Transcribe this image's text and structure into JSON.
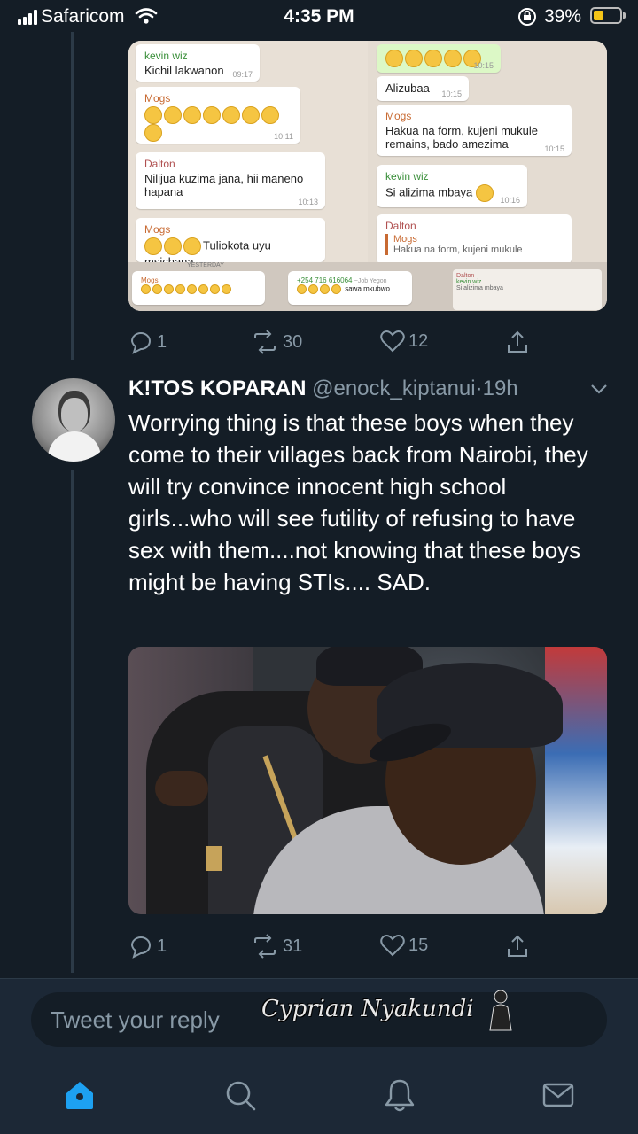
{
  "status_bar": {
    "carrier": "Safaricom",
    "time": "4:35 PM",
    "battery": "39%",
    "battery_level": 0.39
  },
  "quoted_tweet": {
    "chat_messages": [
      {
        "sender": "kevin wiz",
        "text": "Kichil lakwanon",
        "time": "09:17"
      },
      {
        "sender": "Mogs",
        "text": "",
        "time": "10:11"
      },
      {
        "sender": "Dalton",
        "text": "Nilijua kuzima jana, hii maneno hapana",
        "time": "10:13"
      },
      {
        "sender": "Mogs",
        "text": "Tuliokota uyu msichana",
        "time": ""
      },
      {
        "sender": "",
        "text": "",
        "time": "10:15"
      },
      {
        "sender": "",
        "text": "Alizubaa",
        "time": "10:15"
      },
      {
        "sender": "Mogs",
        "text": "Hakua na form, kujeni mukule remains, bado amezima",
        "time": "10:15"
      },
      {
        "sender": "kevin wiz",
        "text": "Si alizima mbaya",
        "time": "10:16"
      },
      {
        "sender": "Dalton",
        "text": "",
        "time": ""
      },
      {
        "sender": "Mogs",
        "text": "Hakua na form, kujeni mukule",
        "time": ""
      }
    ],
    "strip_texts": [
      "Mogs",
      "+254 716 616064",
      "sawa mkubwo",
      "Dalton",
      "kevin wiz",
      "Si alizima mbaya",
      "YESTERDAY",
      "~Job Yegon"
    ],
    "actions": {
      "replies": "1",
      "retweets": "30",
      "likes": "12"
    }
  },
  "tweet": {
    "name": "K!TOS KOPARAN",
    "handle": "@enock_kiptanui",
    "separator": "·",
    "time": "19h",
    "text": "Worrying thing is that these boys when they come to their villages back from Nairobi, they will try convince innocent high school girls...who will see futility of refusing to have sex with them....not knowing that these boys might be having STIs.... SAD.",
    "actions": {
      "replies": "1",
      "retweets": "31",
      "likes": "15"
    }
  },
  "reply": {
    "placeholder": "Tweet your reply",
    "watermark": "Cyprian Nyakundi"
  },
  "tab_bar": {
    "icons": [
      "home-icon",
      "search-icon",
      "notifications-icon",
      "messages-icon"
    ],
    "active_color": "#1da1f2",
    "inactive_color": "#8899a6"
  },
  "colors": {
    "background": "#141d26",
    "secondary_text": "#8899a6",
    "accent": "#1da1f2",
    "battery": "#f5c518"
  }
}
